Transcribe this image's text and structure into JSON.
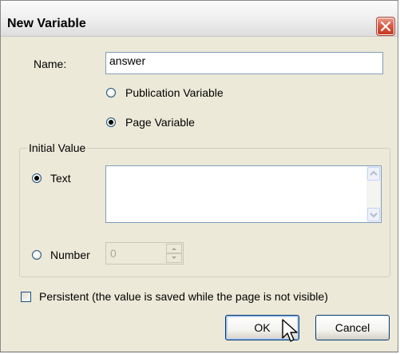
{
  "dialog": {
    "title": "New Variable"
  },
  "name_field": {
    "label": "Name:",
    "value": "answer"
  },
  "scope": {
    "options": [
      {
        "label": "Publication Variable",
        "checked": false
      },
      {
        "label": "Page Variable",
        "checked": true
      }
    ]
  },
  "initial_value": {
    "group_label": "Initial Value",
    "text_option": {
      "label": "Text",
      "checked": true
    },
    "text_value": "",
    "number_option": {
      "label": "Number",
      "checked": false
    },
    "number_value": "0"
  },
  "persistent": {
    "label": "Persistent (the value is saved while the page is not visible)",
    "checked": false
  },
  "buttons": {
    "ok_label": "OK",
    "cancel_label": "Cancel"
  },
  "icons": {
    "close": "close-icon",
    "scroll_up": "scroll-up-arrow-icon",
    "scroll_down": "scroll-down-arrow-icon",
    "spin_up": "spin-up-arrow-icon",
    "spin_down": "spin-down-arrow-icon",
    "cursor": "mouse-pointer-icon"
  },
  "colors": {
    "dialog_bg": "#ece9d8",
    "close_button": "#db5a45",
    "field_border": "#7f9db9",
    "button_border": "#003c74"
  }
}
